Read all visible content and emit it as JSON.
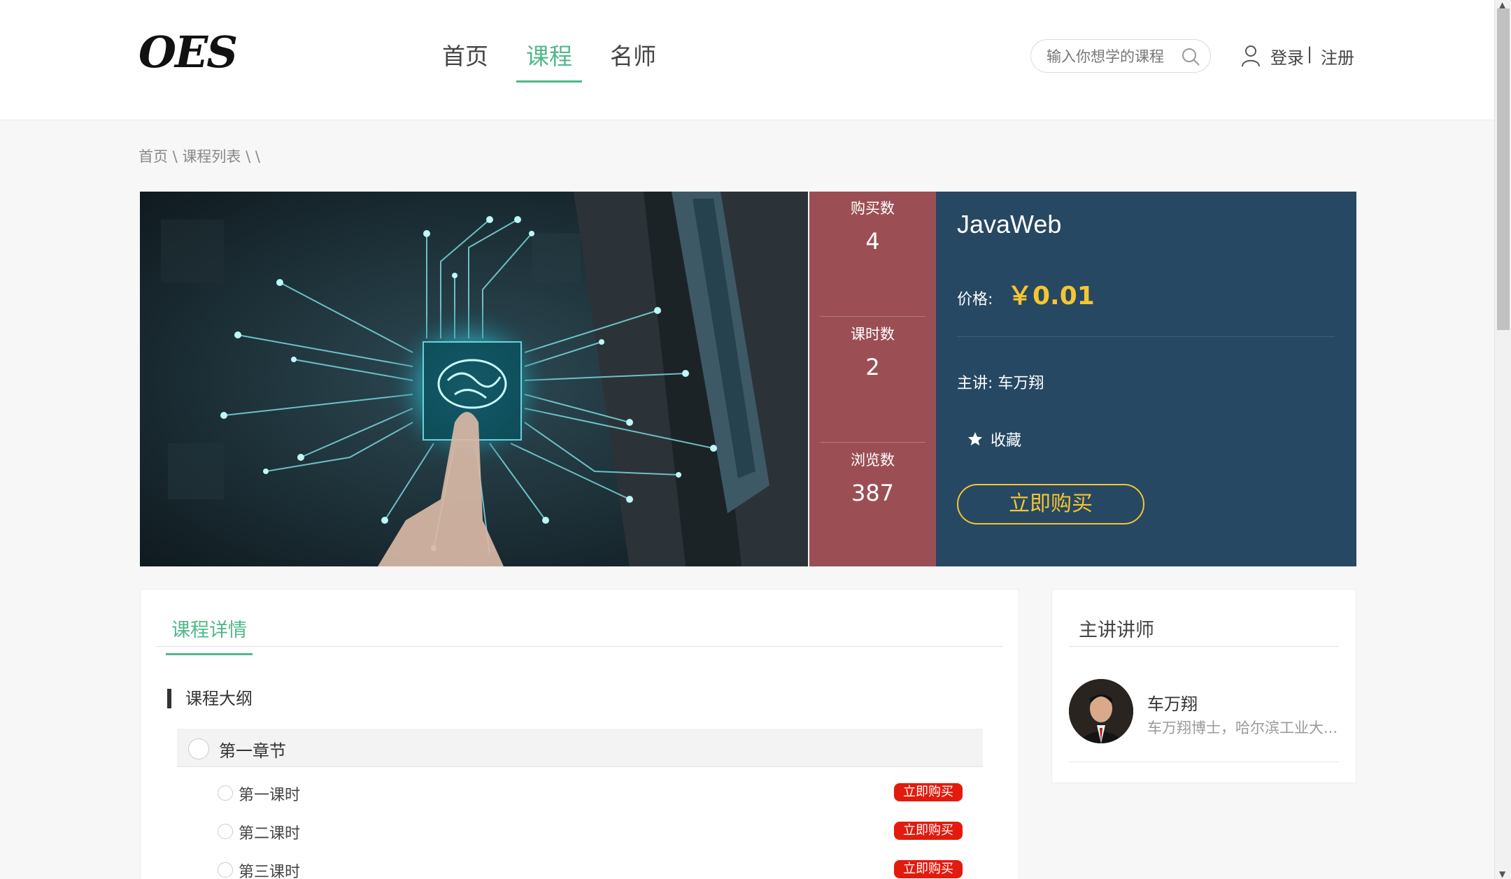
{
  "header": {
    "logo": "OES",
    "nav": [
      "首页",
      "课程",
      "名师"
    ],
    "active_nav": "课程",
    "search_placeholder": "输入你想学的课程",
    "login": "登录",
    "separator": "|",
    "register": "注册"
  },
  "breadcrumb": {
    "home": "首页",
    "sep1": " \\ ",
    "list": "课程列表",
    "tail": " \\ \\"
  },
  "stats": [
    {
      "label": "购买数",
      "value": "4"
    },
    {
      "label": "课时数",
      "value": "2"
    },
    {
      "label": "浏览数",
      "value": "387"
    }
  ],
  "course": {
    "title": "JavaWeb",
    "price_label": "价格:",
    "price": "￥0.01",
    "teacher_label": "主讲:  车万翔",
    "favorite": "收藏",
    "buy_button": "立即购买"
  },
  "details": {
    "tab": "课程详情",
    "outline_title": "课程大纲",
    "chapters": [
      {
        "label": "第一章节",
        "lessons": [
          {
            "label": "第一课时",
            "tag": "立即购买"
          },
          {
            "label": "第二课时",
            "tag": "立即购买"
          },
          {
            "label": "第三课时",
            "tag": "立即购买"
          }
        ]
      }
    ]
  },
  "teacher": {
    "section_title": "主讲讲师",
    "name": "车万翔",
    "desc": "车万翔博士，哈尔滨工业大..."
  },
  "colors": {
    "accent": "#4fb889",
    "stats_bg": "#9b4f55",
    "info_bg": "#264863",
    "price": "#f6c531",
    "tag_red": "#e21b0e"
  },
  "icons": [
    "search-icon",
    "user-icon",
    "star-icon"
  ]
}
